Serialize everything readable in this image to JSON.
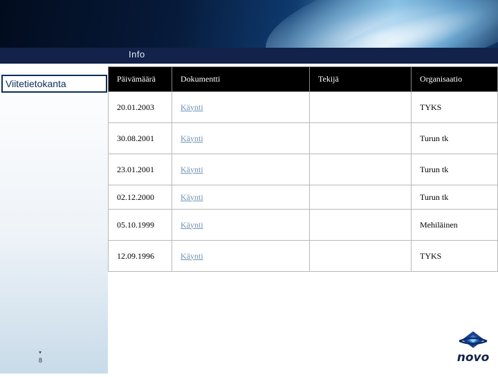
{
  "header": {
    "section_label": "Info"
  },
  "sidebar": {
    "title": "Viitetietokanta"
  },
  "table": {
    "columns": [
      "Päivämäärä",
      "Dokumentti",
      "Tekijä",
      "Organisaatio"
    ],
    "rows": [
      {
        "date": "20.01.2003",
        "document": "Käynti",
        "author": "",
        "organization": "TYKS"
      },
      {
        "date": "30.08.2001",
        "document": "Käynti",
        "author": "",
        "organization": "Turun tk"
      },
      {
        "date": "23.01.2001",
        "document": "Käynti",
        "author": "",
        "organization": "Turun tk"
      },
      {
        "date": "02.12.2000",
        "document": "Käynti",
        "author": "",
        "organization": "Turun tk"
      },
      {
        "date": "05.10.1999",
        "document": "Käynti",
        "author": "",
        "organization": "Mehiläinen"
      },
      {
        "date": "12.09.1996",
        "document": "Käynti",
        "author": "",
        "organization": "TYKS"
      }
    ]
  },
  "footer": {
    "page_number": "8",
    "logo_text": "novo"
  },
  "colors": {
    "header_bar": "#13224a",
    "link": "#6f94b4",
    "table_header": "#000000",
    "logo_blue": "#1a3f8f"
  }
}
